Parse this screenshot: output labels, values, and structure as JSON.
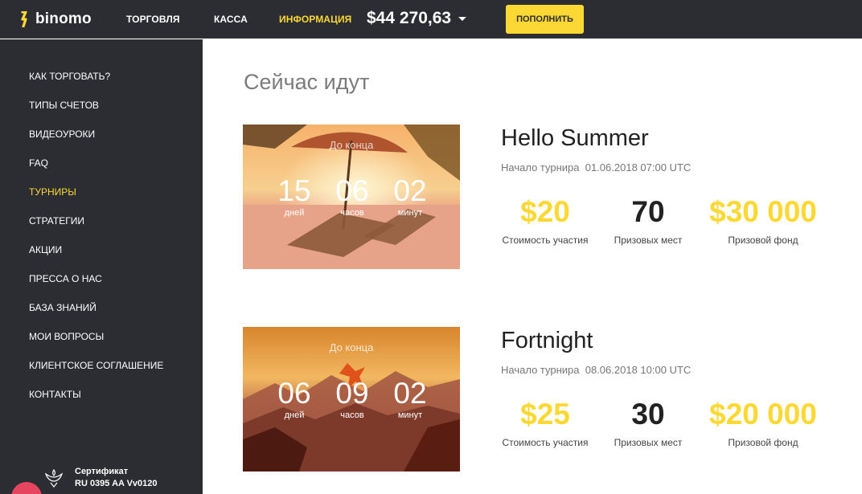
{
  "header": {
    "logo_text": "binomo",
    "nav": [
      {
        "label": "ТОРГОВЛЯ"
      },
      {
        "label": "КАССА"
      },
      {
        "label": "ИНФОРМАЦИЯ",
        "active": true
      }
    ],
    "balance": "$44 270,63",
    "deposit_label": "ПОПОЛНИТЬ"
  },
  "sidebar": {
    "items": [
      {
        "label": "КАК ТОРГОВАТЬ?"
      },
      {
        "label": "ТИПЫ СЧЕТОВ"
      },
      {
        "label": "ВИДЕОУРОКИ"
      },
      {
        "label": "FAQ"
      },
      {
        "label": "ТУРНИРЫ",
        "active": true
      },
      {
        "label": "СТРАТЕГИИ"
      },
      {
        "label": "АКЦИИ"
      },
      {
        "label": "ПРЕССА О НАС"
      },
      {
        "label": "БАЗА ЗНАНИЙ"
      },
      {
        "label": "МОИ ВОПРОСЫ"
      },
      {
        "label": "КЛИЕНТСКОЕ СОГЛАШЕНИЕ"
      },
      {
        "label": "КОНТАКТЫ"
      }
    ],
    "certificate": {
      "title": "Сертификат",
      "number": "RU 0395 AA Vv0120"
    }
  },
  "main": {
    "section_title": "Сейчас идут",
    "tournaments": [
      {
        "name": "Hello Summer",
        "start_label": "Начало турнира",
        "start_value": "01.06.2018 07:00 UTC",
        "countdown_label": "До конца",
        "countdown": [
          {
            "value": "15",
            "caption": "дней"
          },
          {
            "value": "06",
            "caption": "часов"
          },
          {
            "value": "02",
            "caption": "минут"
          }
        ],
        "stats": [
          {
            "value": "$20",
            "caption": "Стоимость участия"
          },
          {
            "value": "70",
            "caption": "Призовых мест"
          },
          {
            "value": "$30 000",
            "caption": "Призовой фонд"
          }
        ]
      },
      {
        "name": "Fortnight",
        "start_label": "Начало турнира",
        "start_value": "08.06.2018 10:00 UTC",
        "countdown_label": "До конца",
        "countdown": [
          {
            "value": "06",
            "caption": "дней"
          },
          {
            "value": "09",
            "caption": "часов"
          },
          {
            "value": "02",
            "caption": "минут"
          }
        ],
        "stats": [
          {
            "value": "$25",
            "caption": "Стоимость участия"
          },
          {
            "value": "30",
            "caption": "Призовых мест"
          },
          {
            "value": "$20 000",
            "caption": "Призовой фонд"
          }
        ]
      }
    ]
  },
  "colors": {
    "accent": "#fcd835",
    "sidebar_bg": "#2c2d32",
    "chat_button": "#e6455f"
  }
}
